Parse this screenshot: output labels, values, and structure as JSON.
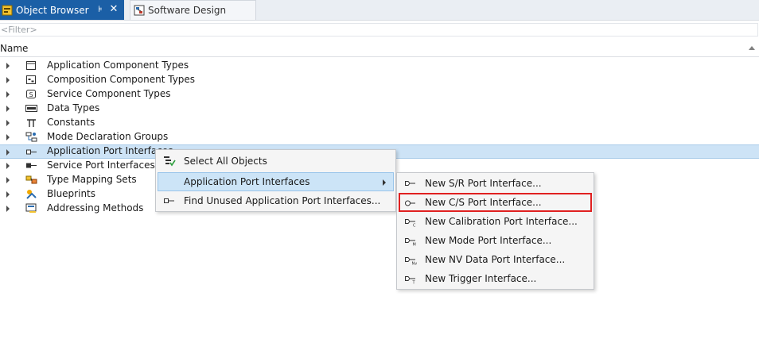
{
  "tabs": [
    {
      "label": "Object Browser",
      "active": true
    },
    {
      "label": "Software Design",
      "active": false
    }
  ],
  "tab_controls": {
    "pin": "⊧",
    "close": "✕"
  },
  "filter": {
    "placeholder": "<Filter>"
  },
  "column": {
    "name": "Name"
  },
  "tree": {
    "items": [
      {
        "label": "Application Component Types",
        "icon": "application-component-icon"
      },
      {
        "label": "Composition Component Types",
        "icon": "composition-component-icon"
      },
      {
        "label": "Service Component Types",
        "icon": "service-component-icon"
      },
      {
        "label": "Data Types",
        "icon": "data-types-icon"
      },
      {
        "label": "Constants",
        "icon": "pi-icon"
      },
      {
        "label": "Mode Declaration Groups",
        "icon": "mode-declaration-icon"
      },
      {
        "label": "Application Port Interfaces",
        "icon": "port-interface-icon"
      },
      {
        "label": "Service Port Interfaces",
        "icon": "service-port-icon"
      },
      {
        "label": "Type Mapping Sets",
        "icon": "type-mapping-icon"
      },
      {
        "label": "Blueprints",
        "icon": "blueprint-icon"
      },
      {
        "label": "Addressing Methods",
        "icon": "addressing-icon"
      }
    ],
    "selected_index": 6
  },
  "context_menu": {
    "items": [
      {
        "label": "Select All Objects",
        "icon": "select-all-icon"
      },
      {
        "label": "Application Port Interfaces",
        "icon": "",
        "has_submenu": true
      },
      {
        "label": "Find Unused Application Port Interfaces...",
        "icon": "port-interface-icon"
      }
    ]
  },
  "submenu": {
    "items": [
      {
        "label": "New S/R Port Interface...",
        "icon": "sr-port-icon"
      },
      {
        "label": "New C/S Port Interface...",
        "icon": "cs-port-icon"
      },
      {
        "label": "New Calibration Port Interface...",
        "icon": "calibration-port-icon"
      },
      {
        "label": "New Mode Port Interface...",
        "icon": "mode-port-icon"
      },
      {
        "label": "New NV Data Port Interface...",
        "icon": "nv-port-icon"
      },
      {
        "label": "New Trigger Interface...",
        "icon": "trigger-port-icon"
      }
    ],
    "highlight_color": "#e02020"
  },
  "colors": {
    "accent": "#1b5fa6",
    "selection": "#cde3f6",
    "menu_hot": "#cce4f7"
  }
}
